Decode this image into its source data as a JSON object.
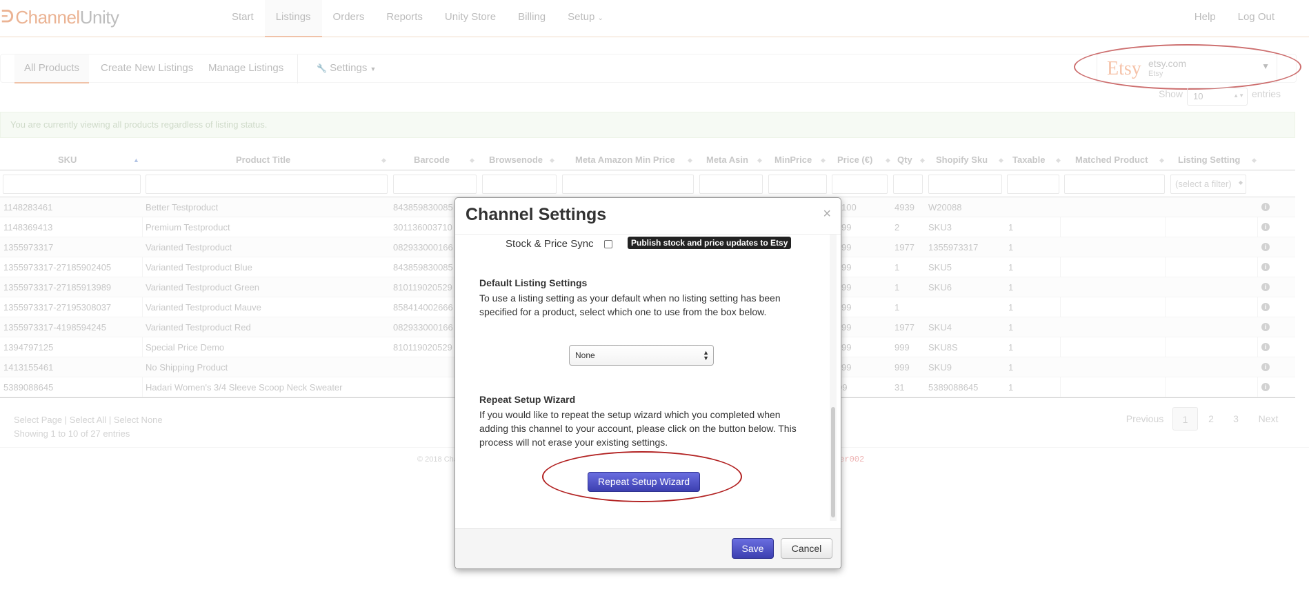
{
  "brand": {
    "logo_mark": "ᕭ",
    "name_part1": "Channel",
    "name_part2": "Unity"
  },
  "nav": {
    "items": [
      "Start",
      "Listings",
      "Orders",
      "Reports",
      "Unity Store",
      "Billing",
      "Setup"
    ],
    "active": "Listings",
    "setup_caret": "⌄",
    "right": [
      "Help",
      "Log Out"
    ]
  },
  "subnav": {
    "tabs": [
      "All Products",
      "Create New Listings",
      "Manage Listings"
    ],
    "settings_label": "Settings",
    "settings_icon": "wrench-icon"
  },
  "channel": {
    "logo_text": "Etsy",
    "name": "etsy.com",
    "sub": "Etsy"
  },
  "table_controls": {
    "show_label": "Show",
    "show_value": "10",
    "entries_label": "entries"
  },
  "info_message": "You are currently viewing all products regardless of listing status.",
  "table": {
    "headers": [
      "SKU",
      "Product Title",
      "Barcode",
      "Browsenode",
      "Meta Amazon Min Price",
      "Meta Asin",
      "MinPrice",
      "Price (€)",
      "Qty",
      "Shopify Sku",
      "Taxable",
      "Matched Product",
      "Listing Setting"
    ],
    "filter_placeholder": "(select a filter)",
    "rows": [
      {
        "sku": "1148283461",
        "title": "Better Testproduct",
        "barcode": "843859830085",
        "price": "100",
        "qty": "4939",
        "shopify": "W20088",
        "taxable": ""
      },
      {
        "sku": "1148369413",
        "title": "Premium Testproduct",
        "barcode": "301136003710",
        "price": "99",
        "qty": "2",
        "shopify": "SKU3",
        "taxable": "1"
      },
      {
        "sku": "1355973317",
        "title": "Varianted Testproduct",
        "barcode": "082933000166",
        "price": "99",
        "qty": "1977",
        "shopify": "1355973317",
        "taxable": "1"
      },
      {
        "sku": "1355973317-27185902405",
        "title": "Varianted Testproduct Blue",
        "barcode": "843859830085",
        "price": "99",
        "qty": "1",
        "shopify": "SKU5",
        "taxable": "1"
      },
      {
        "sku": "1355973317-27185913989",
        "title": "Varianted Testproduct Green",
        "barcode": "810119020529",
        "price": "99",
        "qty": "1",
        "shopify": "SKU6",
        "taxable": "1"
      },
      {
        "sku": "1355973317-27195308037",
        "title": "Varianted Testproduct Mauve",
        "barcode": "858414002666",
        "price": "99",
        "qty": "1",
        "shopify": "",
        "taxable": "1"
      },
      {
        "sku": "1355973317-4198594245",
        "title": "Varianted Testproduct Red",
        "barcode": "082933000166",
        "price": "99",
        "qty": "1977",
        "shopify": "SKU4",
        "taxable": "1"
      },
      {
        "sku": "1394797125",
        "title": "Special Price Demo",
        "barcode": "810119020529",
        "price": "99",
        "qty": "999",
        "shopify": "SKU8S",
        "taxable": "1"
      },
      {
        "sku": "1413155461",
        "title": "No Shipping Product",
        "barcode": "",
        "price": "99",
        "qty": "999",
        "shopify": "SKU9",
        "taxable": "1"
      },
      {
        "sku": "5389088645",
        "title": "Hadari Women's 3/4 Sleeve Scoop Neck Sweater",
        "barcode": "",
        "price": "99",
        "qty": "31",
        "shopify": "5389088645",
        "taxable": "1"
      }
    ]
  },
  "footer_table": {
    "select_page": "Select Page",
    "select_all": "Select All",
    "select_none": "Select None",
    "showing": "Showing 1 to 10 of 27 entries",
    "previous": "Previous",
    "pages": [
      "1",
      "2",
      "3"
    ],
    "next": "Next"
  },
  "footer": {
    "copyright": "© 2018 Cha",
    "user": "ser002"
  },
  "modal": {
    "title": "Channel Settings",
    "close": "×",
    "sync_label": "Stock & Price Sync",
    "sync_tooltip": "Publish stock and price updates to Etsy",
    "default_title": "Default Listing Settings",
    "default_text": "To use a listing setting as your default when no listing setting has been specified for a product, select which one to use from the box below.",
    "default_value": "None",
    "wizard_title": "Repeat Setup Wizard",
    "wizard_text": "If you would like to repeat the setup wizard which you completed when adding this channel to your account, please click on the button below. This process will not erase your existing settings.",
    "wizard_button": "Repeat Setup Wizard",
    "save": "Save",
    "cancel": "Cancel"
  },
  "colors": {
    "accent": "#e8a27a",
    "button": "#4a4dc8",
    "annotation": "#b22222"
  }
}
